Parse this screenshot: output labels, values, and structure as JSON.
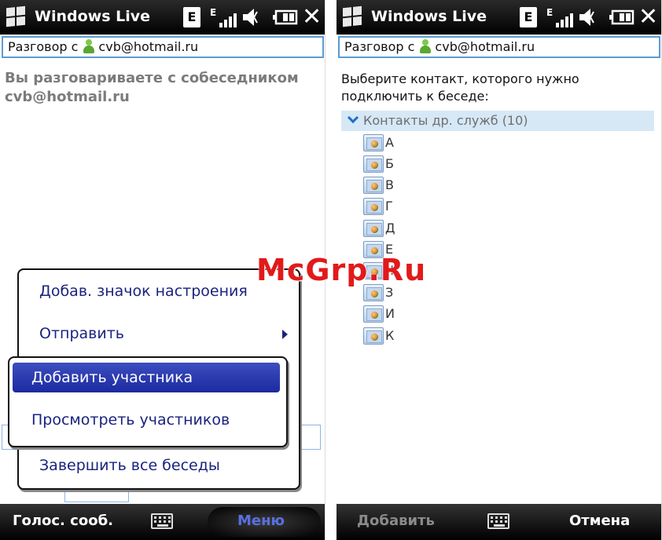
{
  "left_screen": {
    "title": "Windows Live",
    "status_bar": {
      "network": "E"
    },
    "to_bar": {
      "prefix": "Разговор с",
      "contact": "cvb@hotmail.ru"
    },
    "conversation_text": "Вы разговариваете с собеседником cvb@hotmail.ru",
    "menu": {
      "items": [
        "Добав. значок настроения",
        "Отправить",
        "Завершить все беседы"
      ]
    },
    "submenu": {
      "items": [
        "Добавить участника",
        "Просмотреть участников"
      ],
      "selected_index": 0
    },
    "softkeys": {
      "left": "Голос. сооб.",
      "right": "Меню"
    }
  },
  "right_screen": {
    "title": "Windows Live",
    "status_bar": {
      "network": "E"
    },
    "to_bar": {
      "prefix": "Разговор с",
      "contact": "cvb@hotmail.ru"
    },
    "prompt": "Выберите контакт, которого нужно подключить к беседе:",
    "group": {
      "label": "Контакты др. служб (10)"
    },
    "contacts": [
      "А",
      "Б",
      "В",
      "Г",
      "Д",
      "Е",
      "Ж",
      "З",
      "И",
      "К"
    ],
    "softkeys": {
      "left": "Добавить",
      "right": "Отмена"
    }
  },
  "watermark": "McGrp.Ru",
  "colors": {
    "accent_blue": "#5b9bd5",
    "menu_text": "#1a237e",
    "selected_item": "#2a3ab0",
    "group_header_bg": "#d6e8f6",
    "watermark": "#e21a1a"
  }
}
